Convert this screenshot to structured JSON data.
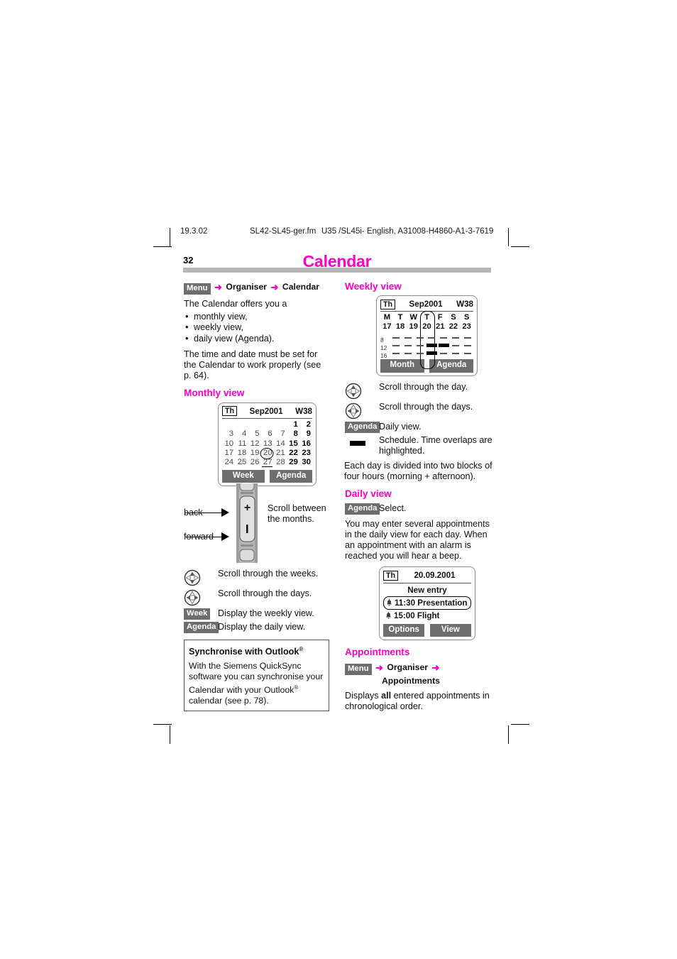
{
  "running_header": {
    "date": "19.3.02",
    "file": "SL42-SL45-ger.fm",
    "doc_id": "U35 /SL45i- English, A31008-H4860-A1-3-7619"
  },
  "page": {
    "number": "32",
    "chapter_title": "Calendar",
    "accent_color": "#ff00c8",
    "key_badge_color": "#6e6e6e"
  },
  "left_column": {
    "nav_path": {
      "key": "Menu",
      "arrow": "➜",
      "step1": "Organiser",
      "step2": "Calendar"
    },
    "intro": "The Calendar offers you a",
    "bullets": [
      "monthly view,",
      "weekly view,",
      "daily view (Agenda)."
    ],
    "note": "The time and date must be set for the Calendar to work properly (see p. 64).",
    "monthly_view": {
      "heading": "Monthly view",
      "screen": {
        "day_badge": "Th",
        "month": "Sep2001",
        "week": "W38",
        "weeks": [
          [
            "",
            "",
            "",
            "",
            "",
            "1",
            "2"
          ],
          [
            "3",
            "4",
            "5",
            "6",
            "7",
            "8",
            "9"
          ],
          [
            "10",
            "11",
            "12",
            "13",
            "14",
            "15",
            "16"
          ],
          [
            "17",
            "18",
            "19",
            "20",
            "21",
            "22",
            "23"
          ],
          [
            "24",
            "25",
            "26",
            "27",
            "28",
            "29",
            "30"
          ]
        ],
        "circled_day": "20",
        "underlined_day": "27",
        "softkeys": [
          "Week",
          "Agenda"
        ]
      },
      "rocker": {
        "back_label": "back",
        "forward_label": "forward",
        "plus": "+",
        "minus": "–",
        "caption": "Scroll between the months."
      },
      "controls": [
        {
          "icon": "nav-updown-icon",
          "text": "Scroll through the weeks."
        },
        {
          "icon": "nav-leftright-icon",
          "text": "Scroll through the days."
        },
        {
          "icon": "key",
          "key_label": "Week",
          "text": "Display the weekly view."
        },
        {
          "icon": "key",
          "key_label": "Agenda",
          "text": "Display the daily view."
        }
      ]
    },
    "outlook_box": {
      "title": "Synchronise with Outlook",
      "title_sup": "®",
      "body_1": "With the Siemens QuickSync software you can synchronise your Calendar with your Outlook",
      "body_sup": "®",
      "body_2": " calendar (see p. 78)."
    }
  },
  "right_column": {
    "weekly_view": {
      "heading": "Weekly view",
      "screen": {
        "day_badge": "Th",
        "month": "Sep2001",
        "week": "W38",
        "dow": [
          "M",
          "T",
          "W",
          "T",
          "F",
          "S",
          "S"
        ],
        "dates": [
          "17",
          "18",
          "19",
          "20",
          "21",
          "22",
          "23"
        ],
        "hour_labels": [
          "8",
          "12",
          "16"
        ],
        "blocks": [
          {
            "row": "12",
            "days": [
              "20",
              "21"
            ]
          },
          {
            "row": "16",
            "days": [
              "20"
            ]
          }
        ],
        "highlighted_day": "20",
        "softkeys": [
          "Month",
          "Agenda"
        ]
      },
      "controls": [
        {
          "icon": "nav-updown-icon",
          "text": "Scroll through the day."
        },
        {
          "icon": "nav-leftright-icon",
          "text": "Scroll through the days."
        },
        {
          "icon": "key",
          "key_label": "Agenda",
          "text": "Daily view."
        },
        {
          "icon": "schedule-bar-icon",
          "text": "Schedule. Time overlaps are highlighted."
        }
      ],
      "footnote": "Each day is divided into two blocks of four hours (morning + afternoon)."
    },
    "daily_view": {
      "heading": "Daily view",
      "select_key": "Agenda",
      "select_text": "Select.",
      "body": "You may enter several appointments in the daily view for each day. When an appointment with an alarm is reached you will hear a beep.",
      "screen": {
        "day_badge": "Th",
        "date": "20.09.2001",
        "new_entry": "New entry",
        "entries": [
          {
            "time_title": "11:30 Presentation",
            "selected": true
          },
          {
            "time_title": "15:00 Flight",
            "selected": false
          }
        ],
        "softkeys": [
          "Options",
          "View"
        ]
      }
    },
    "appointments": {
      "heading": "Appointments",
      "nav_path": {
        "key": "Menu",
        "arrow": "➜",
        "step1": "Organiser",
        "step2": "Appointments"
      },
      "body_pre": "Displays ",
      "body_bold": "all",
      "body_post": " entered appointments in chronological  order."
    }
  }
}
